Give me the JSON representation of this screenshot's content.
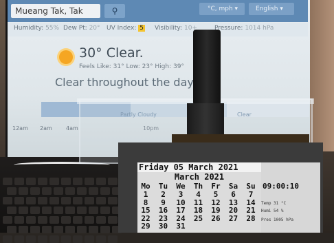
{
  "weather_app": {
    "location": "Mueang Tak, Tak",
    "search_icon": "search-icon",
    "units": "°C, mph ▾",
    "language": "English ▾",
    "stats": {
      "humidity_label": "Humidity:",
      "humidity": "55%",
      "dewpt_label": "Dew Pt:",
      "dewpt": "20°",
      "uv_label": "UV Index:",
      "uv": "5",
      "visibility_label": "Visibility:",
      "visibility": "10+",
      "pressure_label": "Pressure:",
      "pressure": "1014 hPa"
    },
    "current": {
      "icon": "sun-icon",
      "temp_condition": "30° Clear.",
      "feels": "Feels Like: 31°  Low: 23°  High: 39°",
      "summary": "Clear throughout the day."
    },
    "hourly": {
      "partly_label": "Partly Cloudy",
      "clear_label": "Clear",
      "hours": [
        "12am",
        "2am",
        "4am",
        "10pm"
      ]
    }
  },
  "lcd": {
    "date_header": "Friday 05 March 2021",
    "month_title": "March 2021",
    "weekdays": [
      "Mo",
      "Tu",
      "We",
      "Th",
      "Fr",
      "Sa",
      "Su"
    ],
    "weeks": [
      [
        "1",
        "2",
        "3",
        "4",
        "5",
        "6",
        "7"
      ],
      [
        "8",
        "9",
        "10",
        "11",
        "12",
        "13",
        "14"
      ],
      [
        "15",
        "16",
        "17",
        "18",
        "19",
        "20",
        "21"
      ],
      [
        "22",
        "23",
        "24",
        "25",
        "26",
        "27",
        "28"
      ],
      [
        "29",
        "30",
        "31",
        "",
        "",
        "",
        ""
      ]
    ],
    "time": "09:00:10",
    "temp": "Temp 31 °C",
    "humidity": "Humi 54 %",
    "pressure": "Pres 1005 hPa"
  }
}
